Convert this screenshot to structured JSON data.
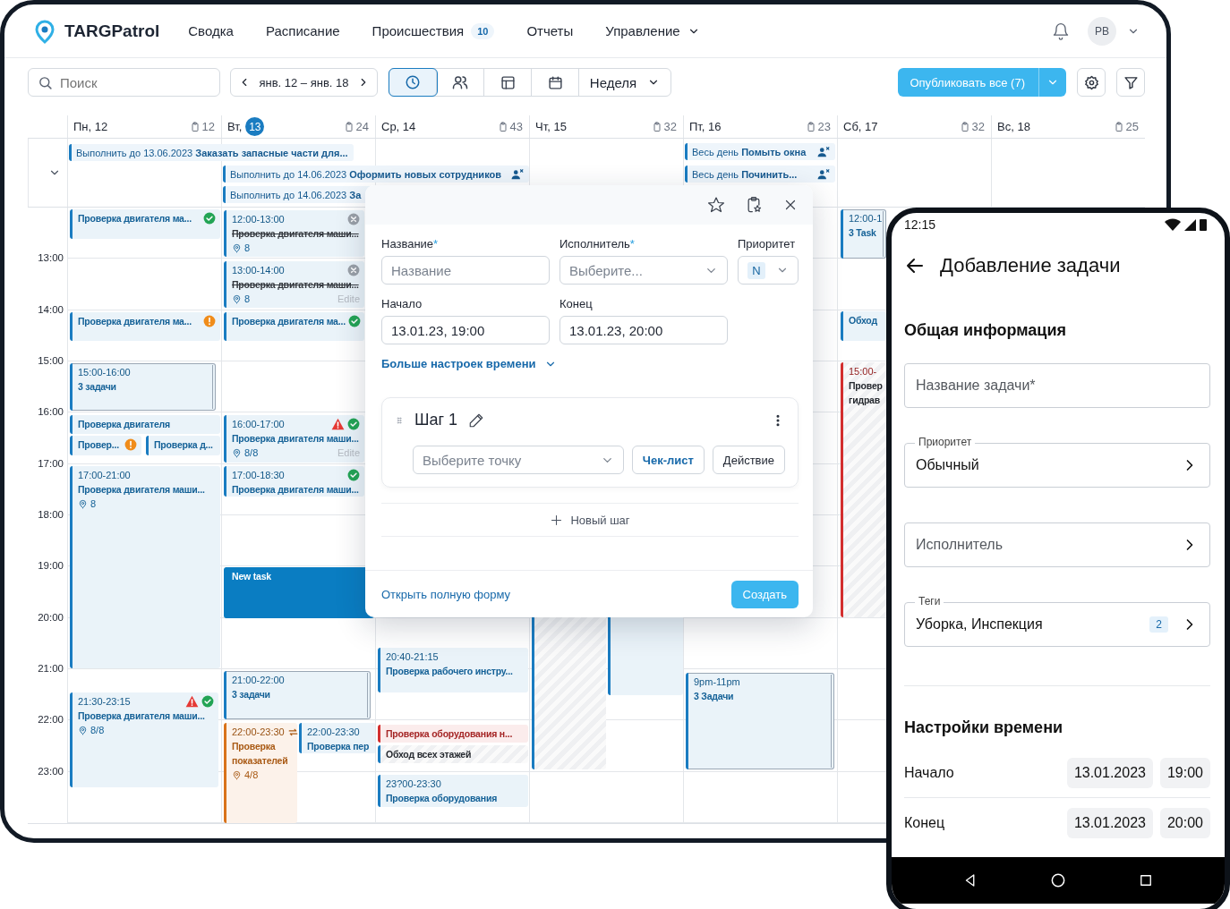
{
  "header": {
    "logo": "TARGPatrol",
    "nav": [
      {
        "label": "Сводка"
      },
      {
        "label": "Расписание"
      },
      {
        "label": "Происшествия",
        "badge": "10"
      },
      {
        "label": "Отчеты"
      },
      {
        "label": "Управление",
        "dropdown": true
      }
    ],
    "avatar": "PB"
  },
  "toolbar": {
    "search": {
      "placeholder": "Поиск"
    },
    "date_range": "янв. 12 – янв. 18",
    "views": [
      {
        "kind": "clock",
        "selected": true
      },
      {
        "kind": "people",
        "selected": false
      },
      {
        "kind": "table",
        "selected": false
      },
      {
        "kind": "calendar",
        "selected": false
      }
    ],
    "period": "Неделя",
    "publish": "Опубликовать все (7)"
  },
  "all_day": [
    {
      "prefix": "Выполнить до 13.06.2023",
      "title": "Заказать запасные части для...",
      "unassigned": false
    },
    {
      "prefix": "Выполнить до 14.06.2023",
      "title": "Оформить новых сотрудников",
      "unassigned": true
    },
    {
      "prefix": "Выполнить до 14.06.2023",
      "title": "За"
    },
    {
      "prefix": "Весь день",
      "title": "Помыть окна",
      "unassigned": true
    },
    {
      "prefix": "Весь день",
      "title": "Починить...",
      "unassigned": true
    }
  ],
  "time_labels": [
    "13:00",
    "14:00",
    "15:00",
    "16:00",
    "17:00",
    "18:00",
    "19:00",
    "20:00",
    "21:00",
    "22:00",
    "23:00"
  ],
  "days": [
    {
      "weekday": "Пн,",
      "date": "12",
      "today": false,
      "count": "12",
      "events": [
        {
          "kind": "task",
          "title": "Проверка двигателя ма...",
          "icons": [
            {
              "kind": "done"
            }
          ],
          "color": "#1a7cc1"
        },
        {
          "kind": "task",
          "title": "Проверка двигателя ма...",
          "icons": [
            {
              "kind": "alert"
            }
          ],
          "color": "#1a7cc1"
        },
        {
          "kind": "stack",
          "time": "15:00-16:00",
          "title": "3 задачи",
          "color": "#1a7cc1"
        },
        {
          "kind": "task",
          "title": "Проверка двигателя",
          "color": "#1a7cc1"
        },
        {
          "kind": "task",
          "title": "Провер...",
          "icons": [
            {
              "kind": "alert"
            }
          ],
          "color": "#1a7cc1"
        },
        {
          "kind": "task",
          "title": "Проверка д...",
          "color": "#1a7cc1"
        },
        {
          "kind": "timed",
          "time": "17:00-21:00",
          "title": "Проверка двигателя маши...",
          "points": "8",
          "color": "#1a7cc1"
        },
        {
          "kind": "timed",
          "time": "21:30-23:15",
          "title": "Проверка двигателя маши...",
          "points": "8/8",
          "icons": [
            {
              "kind": "warning"
            },
            {
              "kind": "done"
            }
          ],
          "color": "#1a7cc1"
        }
      ]
    },
    {
      "weekday": "Вт,",
      "date": "13",
      "today": true,
      "count": "24",
      "events": [
        {
          "kind": "timed",
          "time": "12:00-13:00",
          "title": "Проверка двигателя маши...",
          "points": "8",
          "icons": [
            {
              "kind": "cancelled"
            }
          ],
          "color": "#1a7cc1"
        },
        {
          "kind": "timed",
          "time": "13:00-14:00",
          "title": "Проверка двигателя маши...",
          "points": "8",
          "note": "Edite",
          "icons": [
            {
              "kind": "cancelled"
            }
          ],
          "color": "#1a7cc1"
        },
        {
          "kind": "task",
          "title": "Проверка двигателя ма...",
          "icons": [
            {
              "kind": "done"
            }
          ],
          "color": "#1a7cc1"
        },
        {
          "kind": "timed",
          "time": "16:00-17:00",
          "title": "Проверка двигателя маши...",
          "points": "8/8",
          "note": "Edite",
          "icons": [
            {
              "kind": "warning"
            },
            {
              "kind": "done"
            }
          ],
          "color": "#1a7cc1"
        },
        {
          "kind": "timed",
          "time": "17:00-18:30",
          "title": "Проверка двигателя маши...",
          "icons": [
            {
              "kind": "done"
            }
          ],
          "color": "#1a7cc1"
        },
        {
          "kind": "new",
          "title": "New task",
          "color": "#0a7dc2"
        },
        {
          "kind": "stack",
          "time": "21:00-22:00",
          "title": "3 задачи",
          "color": "#1a7cc1"
        },
        {
          "kind": "timed",
          "time": "22:00-23:30",
          "title": "Проверка показателей",
          "points": "4/8",
          "icons": [
            {
              "kind": "repeat"
            }
          ],
          "color": "#d9731a"
        },
        {
          "kind": "timed",
          "time": "22:00-23:30",
          "title": "Проверка пер",
          "color": "#1a7cc1"
        }
      ]
    },
    {
      "weekday": "Ср,",
      "date": "14",
      "today": false,
      "count": "43",
      "events": [
        {
          "kind": "timed",
          "time": "20:40-21:15",
          "title": "Проверка рабочего инстру...",
          "color": "#1a7cc1"
        },
        {
          "kind": "task",
          "title": "Проверка оборудования н...",
          "color": "#d32f2f"
        },
        {
          "kind": "task",
          "title": "Обход всех этажей",
          "hatched": true,
          "color": "#1a7cc1"
        },
        {
          "kind": "timed",
          "time": "23?00-23:30",
          "title": "Проверка оборудования",
          "color": "#1a7cc1"
        }
      ]
    },
    {
      "weekday": "Чт,",
      "date": "15",
      "today": false,
      "count": "32",
      "events": [
        {
          "kind": "blank",
          "hatched": true,
          "color": "#1a7cc1"
        },
        {
          "kind": "blank",
          "color": "#1a7cc1"
        }
      ]
    },
    {
      "weekday": "Пт,",
      "date": "16",
      "today": false,
      "count": "23",
      "events": [
        {
          "kind": "stack",
          "time": "9pm-11pm",
          "title": "3 Задачи",
          "color": "#1a7cc1"
        }
      ]
    },
    {
      "weekday": "Сб,",
      "date": "17",
      "today": false,
      "count": "32",
      "events": [
        {
          "kind": "stack",
          "time": "12:00-1",
          "title": "3 Task",
          "color": "#1a7cc1"
        },
        {
          "kind": "task",
          "title": "Обход",
          "color": "#1a7cc1"
        },
        {
          "kind": "timed",
          "time": "15:00-",
          "title": "Провер гидрав",
          "hatched": true,
          "color": "#d32f2f"
        }
      ]
    },
    {
      "weekday": "Вс,",
      "date": "18",
      "today": false,
      "count": "25"
    }
  ],
  "popover": {
    "fields": [
      {
        "kind": "input",
        "label": "Название",
        "required_mark": "*",
        "placeholder": "Название"
      },
      {
        "kind": "select",
        "label": "Исполнитель",
        "required_mark": "*",
        "placeholder": "Выберите..."
      },
      {
        "kind": "priority",
        "label": "Приоритет",
        "value": "N"
      }
    ],
    "time_fields": [
      {
        "label": "Начало",
        "value": "13.01.23, 19:00"
      },
      {
        "label": "Конец",
        "value": "13.01.23, 20:00"
      }
    ],
    "more_link": "Больше настроек времени",
    "step": {
      "title": "Шаг 1",
      "point_placeholder": "Выберите точку",
      "buttons": [
        "Чек-лист",
        "Действие"
      ]
    },
    "new_step": "Новый шаг",
    "full_form_link": "Открыть полную форму",
    "create": "Создать"
  },
  "phone": {
    "time": "12:15",
    "title": "Добавление задачи",
    "section": "Общая информация",
    "fields": [
      {
        "kind": "input",
        "placeholder": "Название задачи*"
      },
      {
        "kind": "select",
        "label": "Приоритет",
        "value": "Обычный"
      },
      {
        "kind": "select",
        "placeholder": "Исполнитель"
      },
      {
        "kind": "select",
        "label": "Теги",
        "value": "Уборка, Инспекция",
        "badge": "2"
      }
    ],
    "time_section": "Настройки времени",
    "times": [
      {
        "label": "Начало",
        "date": "13.01.2023",
        "time": "19:00"
      },
      {
        "label": "Конец",
        "date": "13.01.2023",
        "time": "20:00"
      }
    ]
  }
}
